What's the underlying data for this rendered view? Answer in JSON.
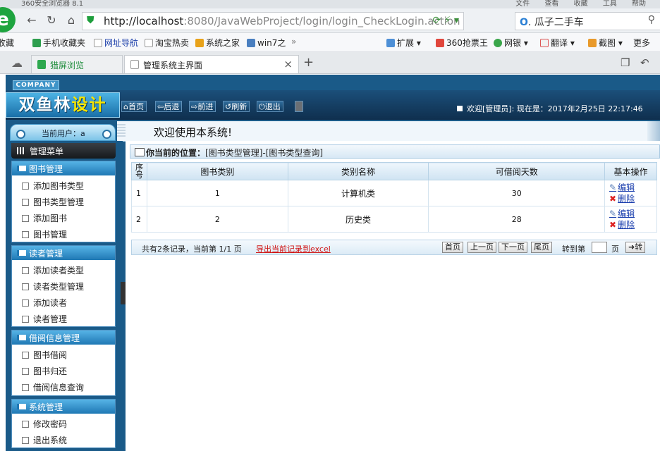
{
  "browser": {
    "window_title": "360安全浏览器 8.1",
    "menu": [
      "文件",
      "查看",
      "收藏",
      "工具",
      "帮助"
    ],
    "url_host": "http://localhost",
    "url_rest": ":8080/JavaWebProject/login/login_CheckLogin.action",
    "search_text": "瓜子二手车",
    "bookmarks": [
      "收藏",
      "手机收藏夹",
      "网址导航",
      "淘宝热卖",
      "系统之家",
      "win7之"
    ],
    "bookmarks_more": "»",
    "ext_items": [
      "扩展",
      "360抢票王",
      "网银",
      "翻译",
      "截图",
      "更多"
    ],
    "tabs": [
      {
        "label": "猎屏浏览"
      },
      {
        "label": "管理系统主界面"
      }
    ],
    "tab_close": "×",
    "new_tab": "+"
  },
  "header": {
    "company": "COMPANY",
    "logo_part1": "双鱼林",
    "logo_part2": "设计",
    "nav": [
      "首页",
      "后退",
      "前进",
      "刷新",
      "退出"
    ],
    "welcome": "欢迎[管理员]:",
    "date_label": "现在是：2017年2月25日 22:17:46"
  },
  "sidebar": {
    "current_user": "当前用户：a",
    "menu_title": "管理菜单",
    "groups": [
      {
        "title": "图书管理",
        "items": [
          "添加图书类型",
          "图书类型管理",
          "添加图书",
          "图书管理"
        ]
      },
      {
        "title": "读者管理",
        "items": [
          "添加读者类型",
          "读者类型管理",
          "添加读者",
          "读者管理"
        ]
      },
      {
        "title": "借阅信息管理",
        "items": [
          "图书借阅",
          "图书归还",
          "借阅信息查询"
        ]
      },
      {
        "title": "系统管理",
        "items": [
          "修改密码",
          "退出系统"
        ]
      }
    ]
  },
  "main": {
    "welcome_title": "欢迎使用本系统!",
    "breadcrumb_label": "你当前的位置：",
    "breadcrumb_path": "[图书类型管理]-[图书类型查询]",
    "table": {
      "headers": [
        "序号",
        "图书类别",
        "类别名称",
        "可借阅天数",
        "基本操作"
      ],
      "rows": [
        {
          "seq": "1",
          "category": "1",
          "name": "计算机类",
          "days": "30"
        },
        {
          "seq": "2",
          "category": "2",
          "name": "历史类",
          "days": "28"
        }
      ],
      "edit_label": "编辑",
      "delete_label": "删除"
    },
    "pager": {
      "info": "共有2条记录，当前第 1/1 页",
      "export": "导出当前记录到excel",
      "first": "首页",
      "prev": "上一页",
      "next": "下一页",
      "last": "尾页",
      "jump_label": "转到第",
      "page_unit": "页",
      "go": "转"
    }
  }
}
